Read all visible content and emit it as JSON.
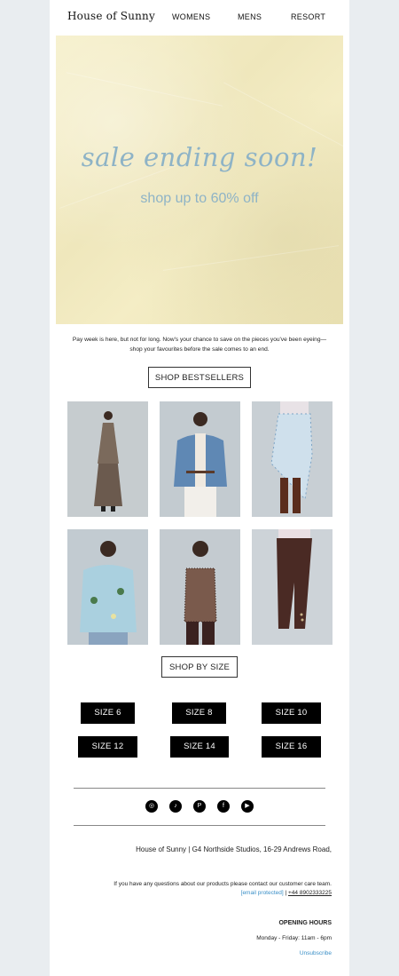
{
  "header": {
    "logo": "House of Sunny",
    "nav": [
      "WOMENS",
      "MENS",
      "RESORT"
    ]
  },
  "hero": {
    "headline": "sale ending soon!",
    "subhead": "shop up to 60% off"
  },
  "intro": {
    "line1": "Pay week is here, but not for long. Now's your chance to save on the pieces you've been eyeing—",
    "line2": "shop your favourites before the sale comes to an end."
  },
  "buttons": {
    "bestsellers": "SHOP BESTSELLERS",
    "by_size": "SHOP BY SIZE"
  },
  "sizes": [
    "SIZE 6",
    "SIZE 8",
    "SIZE 10",
    "SIZE 12",
    "SIZE 14",
    "SIZE 16"
  ],
  "social": [
    {
      "icon": "instagram-icon",
      "glyph": "◎"
    },
    {
      "icon": "tiktok-icon",
      "glyph": "♪"
    },
    {
      "icon": "pinterest-icon",
      "glyph": "P"
    },
    {
      "icon": "facebook-icon",
      "glyph": "f"
    },
    {
      "icon": "youtube-icon",
      "glyph": "▶"
    }
  ],
  "footer": {
    "address": "House of Sunny | G4 Northside Studios, 16-29 Andrews Road,",
    "questions": "If you have any questions about our products please contact our customer care team.",
    "email": "[email protected]",
    "separator": " | ",
    "phone": "+44 8902333225",
    "hours_title": "OPENING HOURS",
    "hours": "Monday - Friday: 11am - 6pm",
    "unsubscribe": "Unsubscribe"
  },
  "colors": {
    "hero_text": "#8eb3c6",
    "link": "#3a8fc7",
    "page_bg": "#e9edf0"
  }
}
